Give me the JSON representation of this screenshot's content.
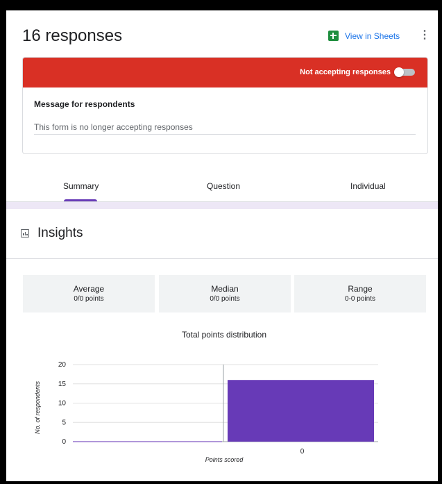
{
  "header": {
    "responses_title": "16 responses",
    "sheets_label": "View in Sheets",
    "more_icon": "more-vert-icon",
    "more_glyph": "⋮"
  },
  "banner": {
    "status_text": "Not accepting responses",
    "accepting": false,
    "color": "#d93025"
  },
  "message": {
    "label": "Message for respondents",
    "value": "This form is no longer accepting responses"
  },
  "tabs": [
    {
      "label": "Summary",
      "active": true
    },
    {
      "label": "Question",
      "active": false
    },
    {
      "label": "Individual",
      "active": false
    }
  ],
  "insights": {
    "title": "Insights",
    "stats": [
      {
        "label": "Average",
        "value": "0/0 points"
      },
      {
        "label": "Median",
        "value": "0/0 points"
      },
      {
        "label": "Range",
        "value": "0-0 points"
      }
    ]
  },
  "chart_data": {
    "type": "bar",
    "title": "Total points distribution",
    "xlabel": "Points scored",
    "ylabel": "No. of respondents",
    "categories": [
      "0"
    ],
    "values": [
      16
    ],
    "ylim": [
      0,
      20
    ],
    "yticks": [
      0,
      5,
      10,
      15,
      20
    ],
    "grid": true,
    "bar_color": "#673ab7"
  },
  "colors": {
    "accent": "#673ab7",
    "link": "#1a73e8",
    "sheets_green": "#1e8e3e"
  }
}
